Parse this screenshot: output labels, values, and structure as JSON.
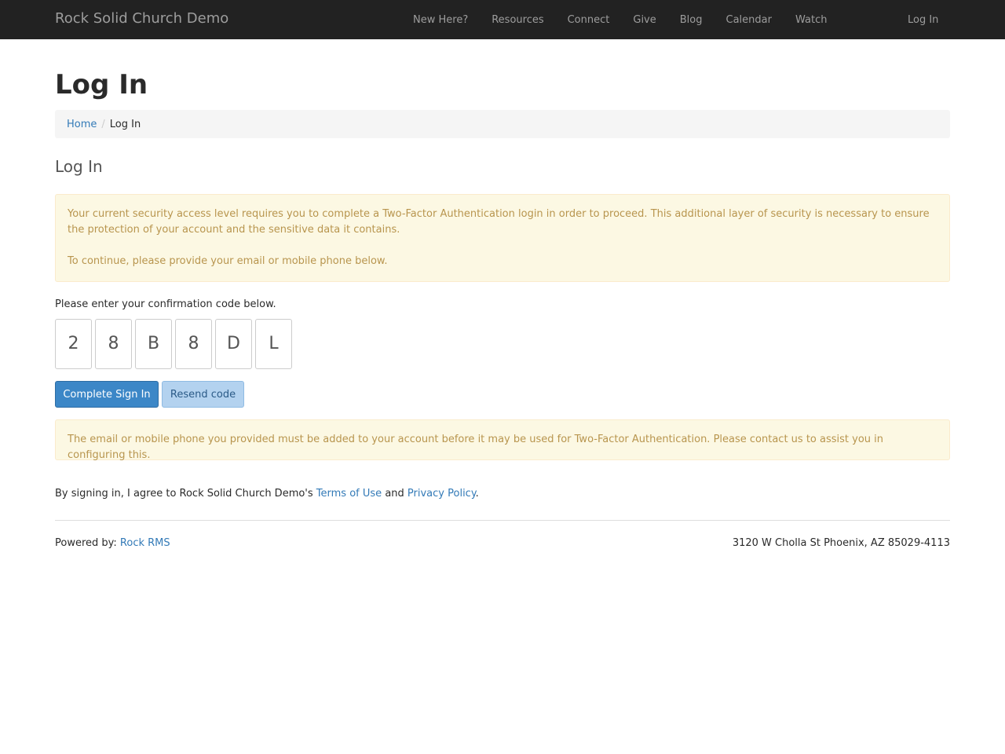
{
  "navbar": {
    "brand": "Rock Solid Church Demo",
    "items": [
      {
        "label": "New Here?"
      },
      {
        "label": "Resources"
      },
      {
        "label": "Connect"
      },
      {
        "label": "Give"
      },
      {
        "label": "Blog"
      },
      {
        "label": "Calendar"
      },
      {
        "label": "Watch"
      }
    ],
    "login_label": "Log In"
  },
  "page": {
    "title": "Log In",
    "breadcrumb": {
      "home": "Home",
      "separator": "/",
      "current": "Log In"
    },
    "section_title": "Log In"
  },
  "alerts": {
    "two_factor_p1": "Your current security access level requires you to complete a Two-Factor Authentication login in order to proceed. This additional layer of security is necessary to ensure the protection of your account and the sensitive data it contains.",
    "two_factor_p2": "To continue, please provide your email or mobile phone below.",
    "not_configured": "The email or mobile phone you provided must be added to your account before it may be used for Two-Factor Authentication. Please contact us to assist you in configuring this."
  },
  "confirmation": {
    "label": "Please enter your confirmation code below.",
    "code": [
      "2",
      "8",
      "B",
      "8",
      "D",
      "L"
    ]
  },
  "buttons": {
    "complete": "Complete Sign In",
    "resend": "Resend code"
  },
  "terms": {
    "prefix": "By signing in, I agree to Rock Solid Church Demo's",
    "terms_link": "Terms of Use",
    "and": "and",
    "privacy_link": "Privacy Policy",
    "suffix": "."
  },
  "footer": {
    "powered_prefix": "Powered by:",
    "powered_link": "Rock RMS",
    "address": "3120 W Cholla St Phoenix, AZ 85029-4113"
  },
  "colors": {
    "navbar_bg": "#222222",
    "link": "#337ab7",
    "alert_bg": "#fcf8e3",
    "alert_text": "#b8954e",
    "primary_button": "#3c87c7",
    "secondary_button": "#b3d2ef"
  }
}
